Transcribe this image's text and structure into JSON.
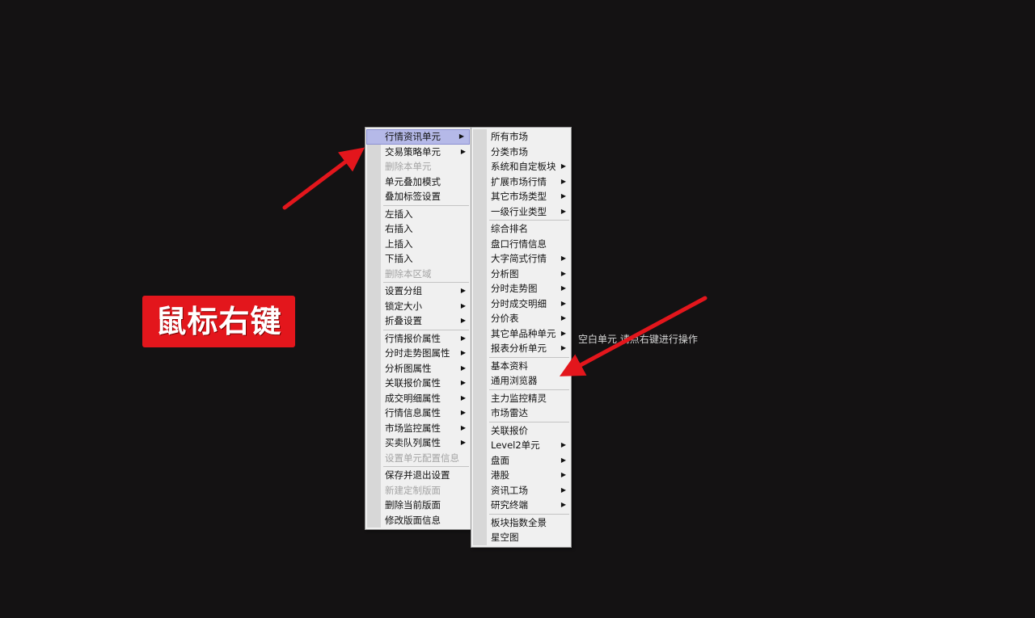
{
  "main_menu": [
    {
      "label": "行情资讯单元",
      "submenu": true,
      "selected": true
    },
    {
      "label": "交易策略单元",
      "submenu": true
    },
    {
      "label": "删除本单元",
      "disabled": true
    },
    {
      "label": "单元叠加模式"
    },
    {
      "label": "叠加标签设置"
    },
    {
      "separator": true
    },
    {
      "label": "左插入"
    },
    {
      "label": "右插入"
    },
    {
      "label": "上插入"
    },
    {
      "label": "下插入"
    },
    {
      "label": "删除本区域",
      "disabled": true
    },
    {
      "separator": true
    },
    {
      "label": "设置分组",
      "submenu": true
    },
    {
      "label": "锁定大小",
      "submenu": true
    },
    {
      "label": "折叠设置",
      "submenu": true
    },
    {
      "separator": true
    },
    {
      "label": "行情报价属性",
      "submenu": true
    },
    {
      "label": "分时走势图属性",
      "submenu": true
    },
    {
      "label": "分析图属性",
      "submenu": true
    },
    {
      "label": "关联报价属性",
      "submenu": true
    },
    {
      "label": "成交明细属性",
      "submenu": true
    },
    {
      "label": "行情信息属性",
      "submenu": true
    },
    {
      "label": "市场监控属性",
      "submenu": true
    },
    {
      "label": "买卖队列属性",
      "submenu": true
    },
    {
      "label": "设置单元配置信息",
      "disabled": true
    },
    {
      "separator": true
    },
    {
      "label": "保存并退出设置"
    },
    {
      "label": "新建定制版面",
      "disabled": true
    },
    {
      "label": "删除当前版面"
    },
    {
      "label": "修改版面信息"
    }
  ],
  "sub_menu": [
    {
      "label": "所有市场"
    },
    {
      "label": "分类市场"
    },
    {
      "label": "系统和自定板块",
      "submenu": true
    },
    {
      "label": "扩展市场行情",
      "submenu": true
    },
    {
      "label": "其它市场类型",
      "submenu": true
    },
    {
      "label": "一级行业类型",
      "submenu": true
    },
    {
      "separator": true
    },
    {
      "label": "综合排名"
    },
    {
      "label": "盘口行情信息"
    },
    {
      "label": "大字简式行情",
      "submenu": true
    },
    {
      "label": "分析图",
      "submenu": true
    },
    {
      "label": "分时走势图",
      "submenu": true
    },
    {
      "label": "分时成交明细",
      "submenu": true
    },
    {
      "label": "分价表",
      "submenu": true
    },
    {
      "label": "其它单品种单元",
      "submenu": true
    },
    {
      "label": "报表分析单元",
      "submenu": true
    },
    {
      "separator": true
    },
    {
      "label": "基本资料"
    },
    {
      "label": "通用浏览器"
    },
    {
      "separator": true
    },
    {
      "label": "主力监控精灵"
    },
    {
      "label": "市场雷达"
    },
    {
      "separator": true
    },
    {
      "label": "关联报价"
    },
    {
      "label": "Level2单元",
      "submenu": true
    },
    {
      "label": "盘面",
      "submenu": true
    },
    {
      "label": "港股",
      "submenu": true
    },
    {
      "label": "资讯工场",
      "submenu": true
    },
    {
      "label": "研究终端",
      "submenu": true
    },
    {
      "separator": true
    },
    {
      "label": "板块指数全景"
    },
    {
      "label": "星空图"
    }
  ],
  "callout": {
    "text": "鼠标右键"
  },
  "hint": {
    "text": "空白单元 请点右键进行操作"
  },
  "colors": {
    "arrow": "#e3161c",
    "callout_bg": "#e3161c",
    "selected_bg": "#b5b9e8"
  }
}
